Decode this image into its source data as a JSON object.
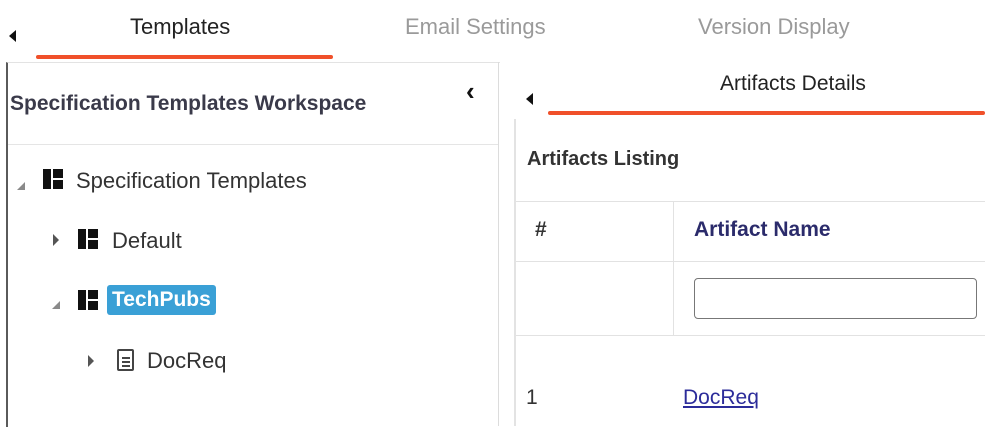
{
  "top_tabs": [
    {
      "label": "Templates",
      "active": true
    },
    {
      "label": "Email Settings",
      "active": false
    },
    {
      "label": "Version Display",
      "active": false
    }
  ],
  "workspace": {
    "title": "Specification Templates Workspace",
    "collapse_glyph": "‹"
  },
  "tree": {
    "root": {
      "label": "Specification Templates",
      "expanded": true,
      "icon": "template-grid-icon"
    },
    "children": [
      {
        "label": "Default",
        "expanded": false,
        "icon": "template-grid-icon"
      },
      {
        "label": "TechPubs",
        "expanded": true,
        "selected": true,
        "icon": "template-grid-icon"
      }
    ],
    "grandchild": {
      "label": "DocReq",
      "expanded": false,
      "icon": "document-icon"
    }
  },
  "details": {
    "tab_label": "Artifacts Details",
    "section_title": "Artifacts Listing",
    "columns": {
      "num": "#",
      "name": "Artifact Name"
    },
    "filter_value": "",
    "rows": [
      {
        "num": "1",
        "name": "DocReq"
      }
    ]
  },
  "colors": {
    "accent": "#f0502a",
    "selection": "#3aa0d6",
    "link": "#2c2c9a"
  }
}
